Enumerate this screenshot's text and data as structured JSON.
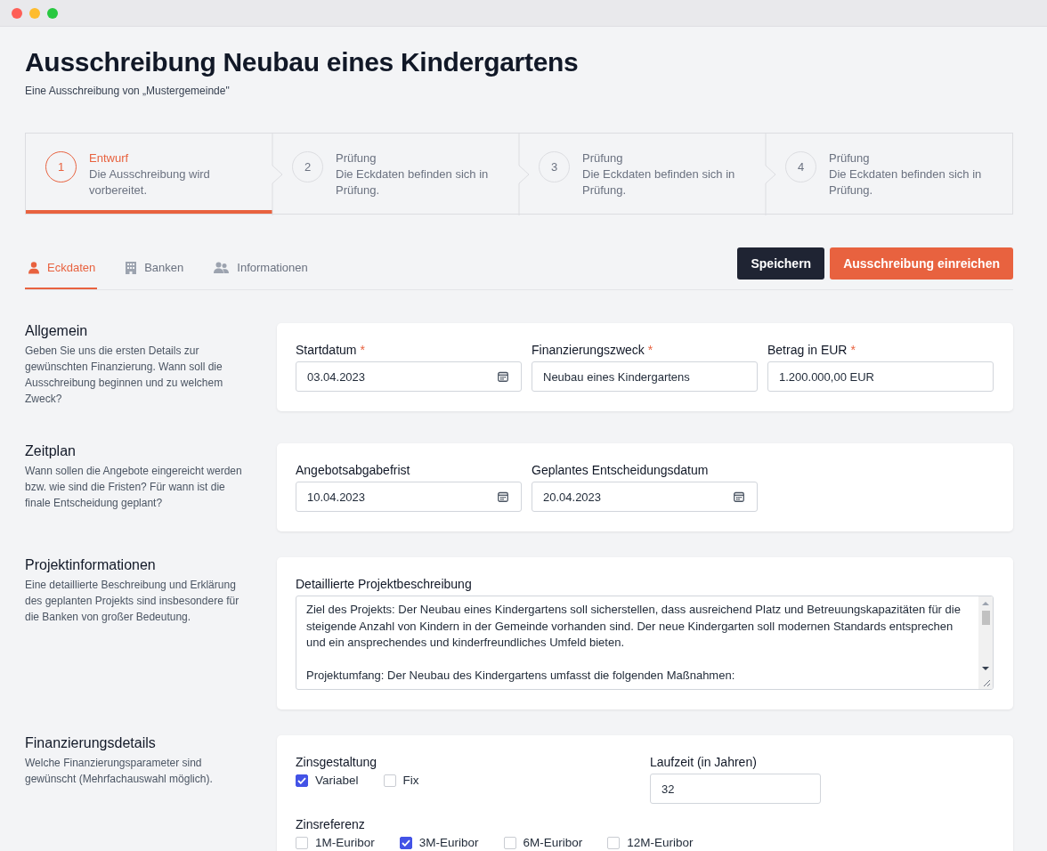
{
  "header": {
    "title": "Ausschreibung Neubau eines Kindergartens",
    "subtitle": "Eine Ausschreibung von „Mustergemeinde\""
  },
  "steps": [
    {
      "number": "1",
      "title": "Entwurf",
      "description": "Die Ausschreibung wird vorbereitet.",
      "selected": true
    },
    {
      "number": "2",
      "title": "Prüfung",
      "description": "Die Eckdaten befinden sich in Prüfung.",
      "selected": false
    },
    {
      "number": "3",
      "title": "Prüfung",
      "description": "Die Eckdaten befinden sich in Prüfung.",
      "selected": false
    },
    {
      "number": "4",
      "title": "Prüfung",
      "description": "Die Eckdaten befinden sich in Prüfung.",
      "selected": false
    }
  ],
  "tabs": [
    {
      "label": "Eckdaten",
      "selected": true
    },
    {
      "label": "Banken",
      "selected": false
    },
    {
      "label": "Informationen",
      "selected": false
    }
  ],
  "actions": [
    {
      "label": "Speichern",
      "kind": "secondary"
    },
    {
      "label": "Ausschreibung einreichen",
      "kind": "primary"
    }
  ],
  "sections": [
    {
      "title": "Allgemein",
      "description": "Geben Sie uns die ersten Details zur gewünschten Finanzierung. Wann soll die Ausschreibung beginnen und zu welchem Zweck?",
      "fields": [
        {
          "kind": "date",
          "label": "Startdatum",
          "required_mark": "*",
          "value": "03.04.2023"
        },
        {
          "kind": "text",
          "label": "Finanzierungszweck",
          "required_mark": "*",
          "value": "Neubau eines Kindergartens"
        },
        {
          "kind": "text",
          "label": "Betrag in EUR",
          "required_mark": "*",
          "value": "1.200.000,00 EUR"
        }
      ]
    },
    {
      "title": "Zeitplan",
      "description": "Wann sollen die Angebote eingereicht werden bzw. wie sind die Fristen? Für wann ist die finale Entscheidung geplant?",
      "fields": [
        {
          "kind": "date",
          "label": "Angebotsabgabefrist",
          "value": "10.04.2023"
        },
        {
          "kind": "date",
          "label": "Geplantes Entscheidungsdatum",
          "value": "20.04.2023"
        }
      ]
    },
    {
      "title": "Projektinformationen",
      "description": "Eine detaillierte Beschreibung und Erklärung des geplanten Projekts sind insbesondere für die Banken von großer Bedeutung.",
      "fields": [
        {
          "kind": "textarea",
          "label": "Detaillierte Projektbeschreibung",
          "value": "Ziel des Projekts: Der Neubau eines Kindergartens soll sicherstellen, dass ausreichend Platz und Betreuungskapazitäten für die steigende Anzahl von Kindern in der Gemeinde vorhanden sind. Der neue Kindergarten soll modernen Standards entsprechen und ein ansprechendes und kinderfreundliches Umfeld bieten.\n\nProjektumfang: Der Neubau des Kindergartens umfasst die folgenden Maßnahmen:"
        }
      ]
    },
    {
      "title": "Finanzierungsdetails",
      "description": "Welche Finanzierungsparameter sind gewünscht (Mehrfachauswahl möglich).",
      "fields": [
        {
          "kind": "checkboxes",
          "label": "Zinsgestaltung",
          "options": [
            {
              "label": "Variabel",
              "checked": true
            },
            {
              "label": "Fix",
              "checked": false
            }
          ]
        },
        {
          "kind": "number",
          "label": "Laufzeit (in Jahren)",
          "value": "32"
        },
        {
          "kind": "checkboxes",
          "label": "Zinsreferenz",
          "options": [
            {
              "label": "1M-Euribor",
              "checked": false
            },
            {
              "label": "3M-Euribor",
              "checked": true
            },
            {
              "label": "6M-Euribor",
              "checked": false
            },
            {
              "label": "12M-Euribor",
              "checked": false
            }
          ]
        }
      ]
    }
  ]
}
